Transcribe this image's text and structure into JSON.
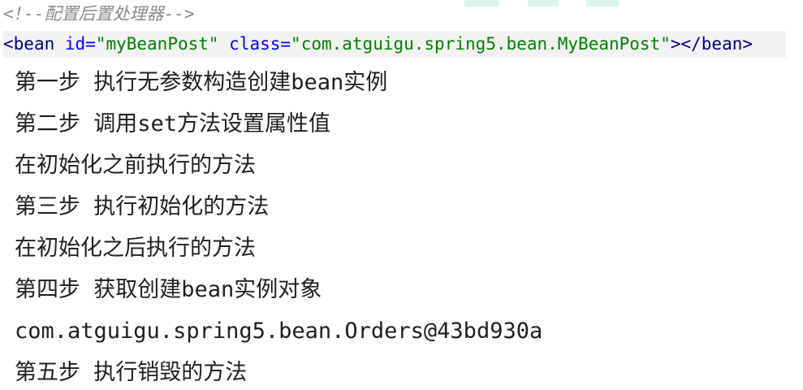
{
  "code": {
    "comment": "<!--配置后置处理器-->",
    "xml": {
      "open_bracket": "<",
      "tag": "bean",
      "attr1_name": " id=",
      "attr1_value": "\"myBeanPost\"",
      "attr2_name": " class=",
      "attr2_value": "\"com.atguigu.spring5.bean.MyBeanPost\"",
      "close_open": "></",
      "close_tag": "bean",
      "close_bracket": ">"
    }
  },
  "console": {
    "lines": [
      "第一步 执行无参数构造创建bean实例",
      "第二步 调用set方法设置属性值",
      "在初始化之前执行的方法",
      "第三步 执行初始化的方法",
      "在初始化之后执行的方法",
      "第四步 获取创建bean实例对象",
      "com.atguigu.spring5.bean.Orders@43bd930a",
      "第五步 执行销毁的方法"
    ]
  },
  "colors": {
    "comment": "#8c8c8c",
    "tag": "#000080",
    "attribute": "#0000ff",
    "value": "#008000",
    "highlight": "#f2f2f2"
  }
}
